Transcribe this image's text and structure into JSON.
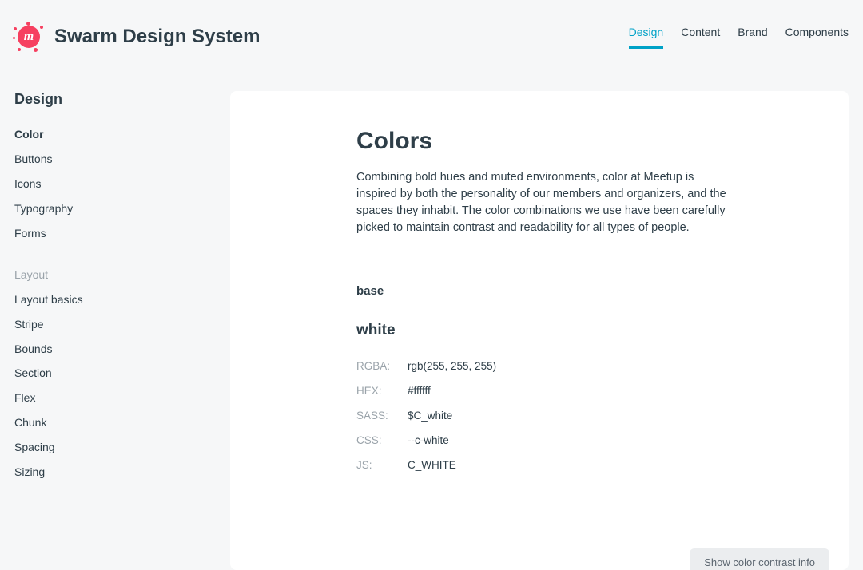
{
  "header": {
    "site_title": "Swarm Design System",
    "nav": [
      {
        "label": "Design",
        "active": true
      },
      {
        "label": "Content",
        "active": false
      },
      {
        "label": "Brand",
        "active": false
      },
      {
        "label": "Components",
        "active": false
      }
    ]
  },
  "sidebar": {
    "heading": "Design",
    "groups": [
      {
        "label": null,
        "items": [
          {
            "label": "Color",
            "current": true
          },
          {
            "label": "Buttons",
            "current": false
          },
          {
            "label": "Icons",
            "current": false
          },
          {
            "label": "Typography",
            "current": false
          },
          {
            "label": "Forms",
            "current": false
          }
        ]
      },
      {
        "label": "Layout",
        "items": [
          {
            "label": "Layout basics",
            "current": false
          },
          {
            "label": "Stripe",
            "current": false
          },
          {
            "label": "Bounds",
            "current": false
          },
          {
            "label": "Section",
            "current": false
          },
          {
            "label": "Flex",
            "current": false
          },
          {
            "label": "Chunk",
            "current": false
          },
          {
            "label": "Spacing",
            "current": false
          },
          {
            "label": "Sizing",
            "current": false
          }
        ]
      }
    ]
  },
  "page": {
    "title": "Colors",
    "intro": "Combining bold hues and muted environments, color at Meetup is inspired by both the personality of our members and organizers, and the spaces they inhabit. The color combinations we use have been carefully picked to maintain contrast and readability for all types of people.",
    "section_label": "base",
    "color": {
      "name": "white",
      "specs": [
        {
          "key": "RGBA:",
          "value": "rgb(255, 255, 255)"
        },
        {
          "key": "HEX:",
          "value": "#ffffff"
        },
        {
          "key": "SASS:",
          "value": "$C_white"
        },
        {
          "key": "CSS:",
          "value": "--c-white"
        },
        {
          "key": "JS:",
          "value": "C_WHITE"
        }
      ]
    },
    "contrast_button": "Show color contrast info"
  }
}
